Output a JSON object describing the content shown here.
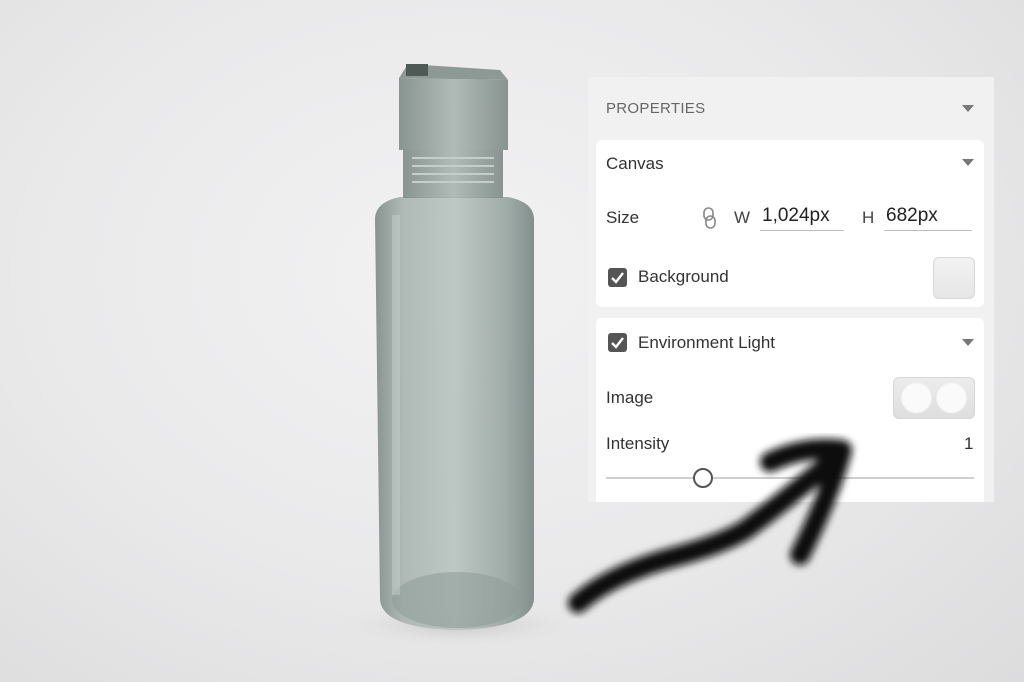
{
  "panel": {
    "title": "PROPERTIES",
    "canvas": {
      "title": "Canvas",
      "size_label": "Size",
      "width_letter": "W",
      "width_value": "1,024px",
      "height_letter": "H",
      "height_value": "682px",
      "background_label": "Background",
      "background_checked": true
    },
    "environment_light": {
      "title": "Environment Light",
      "checked": true,
      "image_label": "Image",
      "intensity_label": "Intensity",
      "intensity_value": "1"
    }
  },
  "icons": [
    "chevron-down-icon",
    "link-icon",
    "checkbox-checked-icon"
  ],
  "colors": {
    "panel_bg": "#f1f1f1",
    "card_bg": "#ffffff",
    "annotation_stroke": "#111111"
  }
}
